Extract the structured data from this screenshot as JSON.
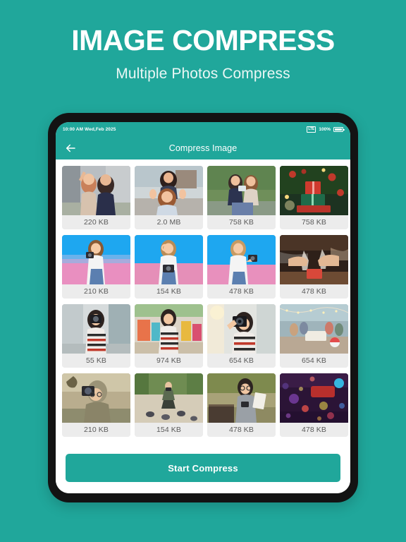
{
  "promo": {
    "title": "IMAGE COMPRESS",
    "subtitle": "Multiple Photos Compress"
  },
  "colors": {
    "brand_teal": "#20a79b",
    "bezel_black": "#131313",
    "card_label_bg": "#ececec",
    "screen_white": "#ffffff"
  },
  "statusbar": {
    "time": "10:00 AM Wed,Feb 2025",
    "network_badge": "LTE",
    "battery_percent": "100%",
    "battery_icon": "battery-full-icon"
  },
  "appbar": {
    "back_icon": "back-arrow-icon",
    "title": "Compress Image"
  },
  "grid": {
    "rows": [
      [
        {
          "size": "220 KB",
          "alt": "two-women-selfie-city"
        },
        {
          "size": "2.0 MB",
          "alt": "two-women-posing-street"
        },
        {
          "size": "758 KB",
          "alt": "two-women-selfie-park-bench"
        },
        {
          "size": "758 KB",
          "alt": "christmas-gifts-tree"
        }
      ],
      [
        {
          "size": "210 KB",
          "alt": "woman-holding-camera-pink-blue"
        },
        {
          "size": "154 KB",
          "alt": "woman-ok-sign-camera-blue"
        },
        {
          "size": "478 KB",
          "alt": "woman-with-camera-gradient"
        },
        {
          "size": "478 KB",
          "alt": "hands-toasting-champagne"
        }
      ],
      [
        {
          "size": "55 KB",
          "alt": "woman-striped-sweater-shooting"
        },
        {
          "size": "974 KB",
          "alt": "woman-striped-sweater-fair"
        },
        {
          "size": "654 KB",
          "alt": "woman-camera-closeup-street"
        },
        {
          "size": "654 KB",
          "alt": "friends-picnic-beach-lights"
        }
      ],
      [
        {
          "size": "210 KB",
          "alt": "man-photographing-autumn"
        },
        {
          "size": "154 KB",
          "alt": "man-crouching-pigeons-path"
        },
        {
          "size": "478 KB",
          "alt": "woman-reading-park-bench"
        },
        {
          "size": "478 KB",
          "alt": "bokeh-neon-lights-night"
        }
      ]
    ]
  },
  "footer": {
    "start_label": "Start Compress"
  }
}
